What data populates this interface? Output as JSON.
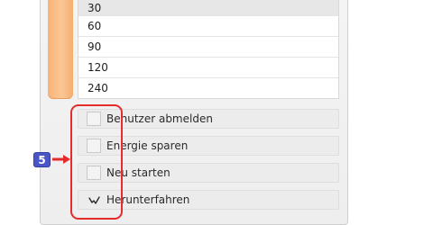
{
  "time_list": {
    "items": [
      "30",
      "60",
      "90",
      "120",
      "240"
    ],
    "selected_index": 0
  },
  "options": [
    {
      "label": "Benutzer abmelden",
      "checked": false
    },
    {
      "label": "Energie sparen",
      "checked": false
    },
    {
      "label": "Neu starten",
      "checked": false
    },
    {
      "label": "Herunterfahren",
      "checked": true
    }
  ],
  "annotation": {
    "step_number": "5",
    "color": "#e52b2b",
    "badge_color": "#4a56c6"
  },
  "colors": {
    "orange_bar": "#fcc795",
    "selected_row": "#e7e7e7"
  }
}
